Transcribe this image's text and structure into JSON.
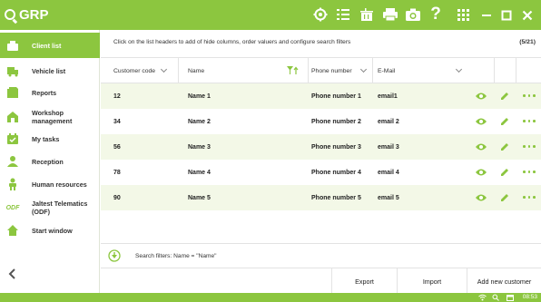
{
  "app": {
    "logo_text": "GRP"
  },
  "topbar": {
    "icons": [
      "settings-icon",
      "list-icon",
      "trash-icon",
      "printer-icon",
      "camera-icon",
      "help-icon",
      "apps-grid-icon"
    ],
    "help_label": "?",
    "window_buttons": [
      "minimize-icon",
      "maximize-icon",
      "close-icon"
    ]
  },
  "sidebar": {
    "items": [
      {
        "label": "Client list",
        "icon": "client-icon",
        "active": true
      },
      {
        "label": "Vehicle list",
        "icon": "vehicle-icon",
        "active": false
      },
      {
        "label": "Reports",
        "icon": "reports-icon",
        "active": false
      },
      {
        "label": "Workshop management",
        "icon": "workshop-icon",
        "active": false
      },
      {
        "label": "My tasks",
        "icon": "tasks-icon",
        "active": false
      },
      {
        "label": "Reception",
        "icon": "reception-icon",
        "active": false
      },
      {
        "label": "Human resources",
        "icon": "hr-icon",
        "active": false
      },
      {
        "label": "Jaltest Telematics (ODF)",
        "icon": "odf-icon",
        "active": false
      },
      {
        "label": "Start window",
        "icon": "home-icon",
        "active": false
      }
    ],
    "odf_badge": "ODF"
  },
  "main": {
    "hint": "Click on the list headers to add of hide columns, order valuers and configure search filters",
    "count": "(5/21)",
    "columns": [
      "Customer code",
      "Name",
      "Phone number",
      "E-Mail"
    ],
    "rows": [
      {
        "code": "12",
        "name": "Name 1",
        "phone": "Phone number 1",
        "email": "email1"
      },
      {
        "code": "34",
        "name": "Name 2",
        "phone": "Phone number 2",
        "email": "email 2"
      },
      {
        "code": "56",
        "name": "Name 3",
        "phone": "Phone number 3",
        "email": "email 3"
      },
      {
        "code": "78",
        "name": "Name 4",
        "phone": "Phone number 4",
        "email": "email 4"
      },
      {
        "code": "90",
        "name": "Name 5",
        "phone": "Phone number 5",
        "email": "email 5"
      }
    ],
    "filter_text": "Search filters: Name = \"Name\"",
    "buttons": {
      "export": "Export",
      "import": "Import",
      "add": "Add new customer"
    }
  },
  "statusbar": {
    "time": "08:53"
  },
  "colors": {
    "accent": "#8cc63f",
    "row_alt": "#f3f8e7"
  }
}
